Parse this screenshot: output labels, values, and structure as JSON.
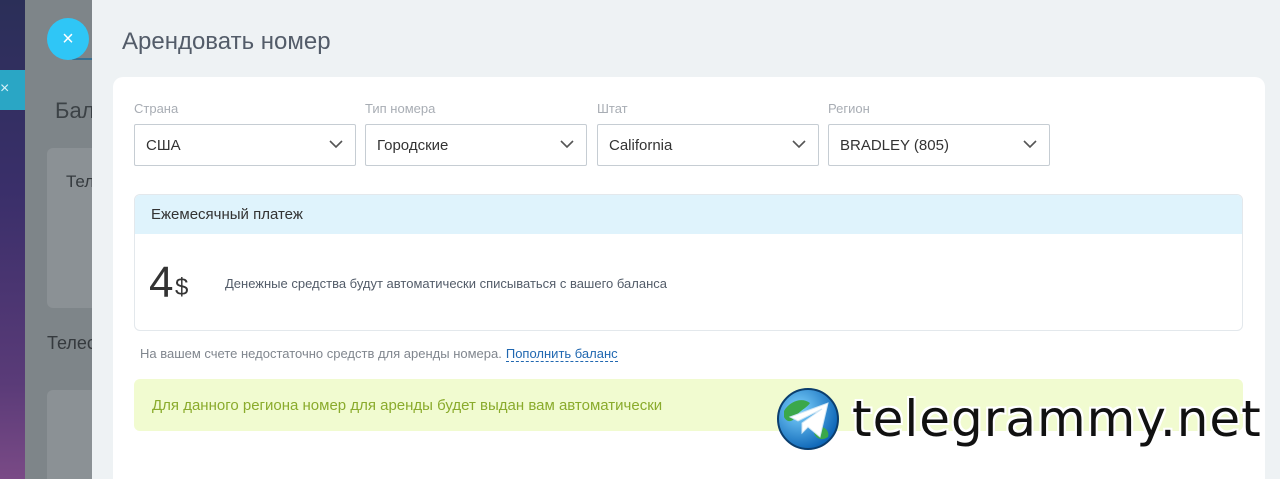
{
  "background": {
    "heading": "Бал",
    "card_text": "Тел",
    "heading2": "Телес"
  },
  "dialog": {
    "close_symbol": "×",
    "title": "Арендовать номер"
  },
  "fields": [
    {
      "label": "Страна",
      "value": "США"
    },
    {
      "label": "Тип номера",
      "value": "Городские"
    },
    {
      "label": "Штат",
      "value": "California"
    },
    {
      "label": "Регион",
      "value": "BRADLEY (805)"
    }
  ],
  "payment": {
    "header": "Ежемесячный платеж",
    "amount": "4",
    "currency": "$",
    "note": "Денежные средства будут автоматически списываться с вашего баланса"
  },
  "warning": {
    "text": "На вашем счете недостаточно средств для аренды номера.",
    "link": "Пополнить баланс"
  },
  "info": {
    "text": "Для данного региона номер для аренды будет выдан вам автоматически"
  },
  "watermark": {
    "text": "telegrammy.net"
  },
  "colors": {
    "accent": "#2fc6f6",
    "payment_header_bg": "#dff3fc",
    "info_bg": "#f1fbd0",
    "info_text": "#8aab2c",
    "link": "#2067b0"
  }
}
